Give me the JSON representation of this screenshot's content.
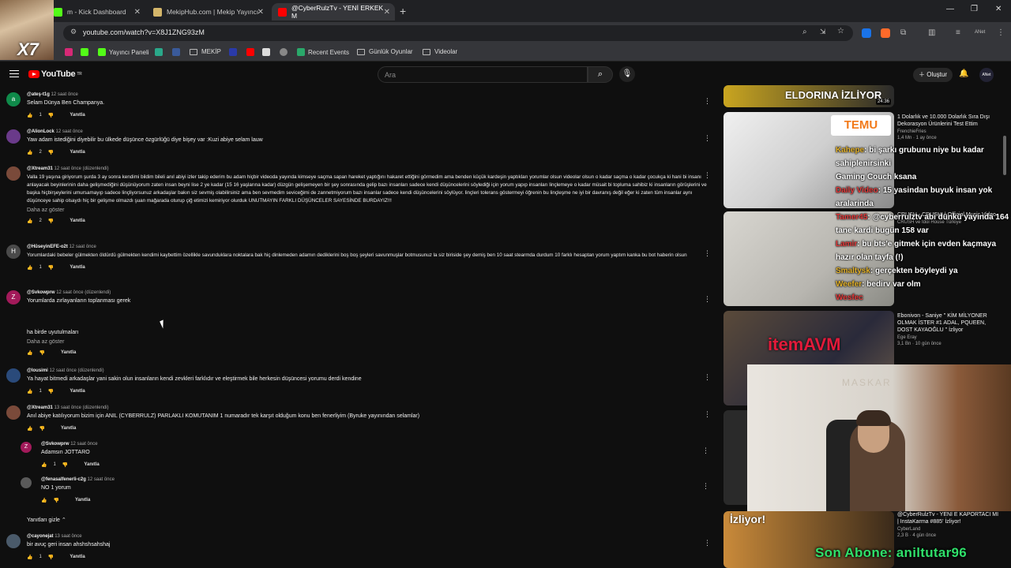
{
  "browser": {
    "tabs": [
      {
        "label": "m - Kick Dashboard",
        "color": "#53fc18"
      },
      {
        "label": "MekipHub.com | Mekip Yayıncı",
        "color": "#d4b66a"
      },
      {
        "label": "@CyberRulzTv - YENİ ERKEK M",
        "color": "#ff0000"
      }
    ],
    "url": "youtube.com/watch?v=X8J1ZNG93zM",
    "bookmarks": [
      "Yayıncı Paneli",
      "MEKİP",
      "Recent Events",
      "Günlük Oyunlar",
      "Videolar"
    ],
    "webcam_logo": "X7"
  },
  "youtube": {
    "logo_text": "YouTube",
    "logo_region": "TR",
    "search_placeholder": "Ara",
    "create_label": "Oluştur",
    "avatar_label": "ANet"
  },
  "comments": [
    {
      "avatar": "a",
      "avatar_color": "#0f8a4a",
      "author": "@ateş-t1g",
      "time": "12 saat önce",
      "text": "Selam Dünya Ben Champanya.",
      "likes": "1",
      "reply": "Yanıtla"
    },
    {
      "avatar": "",
      "avatar_color": "#6a3a8a",
      "author": "@AlionLock",
      "time": "12 saat önce",
      "text": "Yaw adam istediğini diyebilir bu ülkede düşünce özgürlüğü diye bişey var :Kuzi abiye selam lauw",
      "likes": "2",
      "reply": "Yanıtla"
    },
    {
      "avatar": "",
      "avatar_color": "#7a4a3a",
      "author": "@Xtream31",
      "time": "12 saat önce (düzenlendi)",
      "text": "Valla 19 yaşına giriyorum şurda 3 ay sonra kendimi bildim bileli anıl abiyi izler takip ederim bu adam hiçbir videoda yayında kimseye saçma sapan hareket yaptığını hakaret ettiğini görmedim ama benden küçük kardeşin yaptıkları yorumlar olsun videolar olsun o kadar saçma o kadar çocukça ki hani bi insanı anlayacak beyinlerinin daha gelişmediğini düşünüyorum zaten insan beyni lise 2 ye kadar (15 16 yaşlarına kadar) düzgün gelişemeyen bir şey sonrasında gelip bazı insanları sadece kendi düşüncelerini söylediği için yorum yapıp insanları linçlemeye o kadar müsait bi topluma sahibiz ki insanların görüşlerini ve başka hiçbirşeylerini umursamayıp sadece linçliyorsunuz arkadaşlar bakın siz sevmiş olabilirsiniz ama ben sevmedim seviceğimi de zannetmiyorum bazı insanlar sadece kendi düşüncelerini söylüyor. linçleri tolerans göstermeyi öğrenin bu linçleşme ne iyi bir davranış değil eğer ki zaten tüm insanlar aynı düşünceye sahip olsaydı hiç bir gelişme olmazdı şuan mağarada oturup çiğ etimizi kemiriyor olurduk UNUTMAYIN FARKLI DÜŞÜNCELER SAYESİNDE BURDAYIZ!!!",
      "more": "Daha az göster",
      "likes": "2",
      "reply": "Yanıtla"
    },
    {
      "avatar": "H",
      "avatar_color": "#4a4a4a",
      "author": "@HüseyinEFE-o2t",
      "time": "12 saat önce",
      "text": "Yorumlardaki bebeler gülmekten öldürdü gülmekten kendimi kaybettim özellikle savunduklara noktalara bak hiç dinlemeden adamın dediklerini boş boş şeyleri savunmuşlar botmusunuz la siz biriside şey demiş ben 10 saat stearmda durdum 10 farklı hesaptan yorum yaptım kanka bu bot haberin olsun",
      "likes": "1",
      "reply": "Yanıtla"
    },
    {
      "avatar": "Z",
      "avatar_color": "#a21a5a",
      "author": "@Svkowprw",
      "time": "12 saat önce (düzenlendi)",
      "text": "Yorumlarda zırlayanların toplanması gerek",
      "text2": "ha birde uyutulmaları",
      "more": "Daha az göster",
      "likes": "",
      "reply": "Yanıtla"
    },
    {
      "avatar": "",
      "avatar_color": "#2a4a7a",
      "author": "@lousimi",
      "time": "12 saat önce (düzenlendi)",
      "text": "Ya hayat bitmedi arkadaşlar yani sakin olun insanların kendi zevkleri farklıdır ve eleştirmek bile herkesin düşüncesi yorumu derdi kendine",
      "likes": "1",
      "reply": "Yanıtla"
    },
    {
      "avatar": "",
      "avatar_color": "#7a4a3a",
      "author": "@Xtream31",
      "time": "13 saat önce (düzenlendi)",
      "text": "Anıl abiye katılıyorum bizim için ANIL (CYBERRULZ) PARLAKLI KOMUTANIM 1 numaradır tek karşıt olduğum konu ben fenerliyim (Byruke yayınından selamlar)",
      "likes": "",
      "reply": "Yanıtla"
    },
    {
      "avatar": "Z",
      "avatar_color": "#a21a5a",
      "author": "@Svkowprw",
      "time": "12 saat önce",
      "text": "Adamsın JOTTARO",
      "likes": "1",
      "reply": "Yanıtla",
      "nested": true
    },
    {
      "avatar": "",
      "avatar_color": "#5a5a5a",
      "author": "@fenasalfenerli-c2g",
      "time": "12 saat önce",
      "text": "NO 1 yorum",
      "likes": "",
      "reply": "Yanıtla",
      "nested": true
    },
    {
      "avatar": "",
      "avatar_color": "#4a5a6a",
      "author": "@cayonejat",
      "time": "13 saat önce",
      "text": "bir avuç geri insan ahshshsahshaj",
      "likes": "1",
      "reply": "Yanıtla"
    }
  ],
  "hide_replies": "Yanıtları gizle",
  "related": [
    {
      "title": "ELDORINA İZLİYOR",
      "channel": "",
      "duration": "24:36"
    },
    {
      "title": "1 Dolarlık ve 10.000 Dolarlık Sıra Dışı Dekorasyon Ürünlerini Test Ettim",
      "channel": "FrenchieFries",
      "meta": "1,4 Mn · 1 ay önce"
    },
    {
      "title": "CRUSH - CRUSH! | Official Music Video",
      "channel": "CRUSH ve Idol House Türkiye",
      "meta": ""
    },
    {
      "title": "Ebonivon - Saniye \" KİM MİLYONER OLMAK İSTER #1 ADAL, PQUEEN, DOST KAYAOĞLU \" İzliyor",
      "channel": "Ege Eray",
      "meta": "3,1 Bn · 10 gün önce"
    },
    {
      "title": "@CyberRulzTv - YENİ E KAPORTACI MI | InstaKarma #885' İzliyor!",
      "channel": "CyberLand",
      "meta": "2,3 B · 4 gün önce"
    }
  ],
  "overlays": {
    "temu": "TEMU",
    "itemavm": "itemAVM",
    "sub_text": "Son Abone: aniltutar96",
    "cam_text": "MASKAR",
    "chat": [
      {
        "user": "Kahepe",
        "msg": ": bi şarkı grubunu niye bu kadar sahiplenirsinki"
      },
      {
        "user": "Gaming Couch",
        "msg": "ksana"
      },
      {
        "user": "Daily Video",
        "msg": ": 15 yasindan buyuk insan yok aralarinda"
      },
      {
        "user": "Tamer45",
        "msg": ": @cyberrulztv abi dünkü yayında 164 tane kardi bugün 158 var"
      },
      {
        "user": "Lamir",
        "msg": ": bu bts'e gitmek için evden kaçmaya hazır olan tayfa (!)"
      },
      {
        "user": "Smaltysk",
        "msg": ": gerçekten böyleydi ya"
      },
      {
        "user": "Weefer",
        "msg": ": bedirv var olm"
      },
      {
        "user": "Wesfec",
        "msg": ""
      }
    ]
  }
}
